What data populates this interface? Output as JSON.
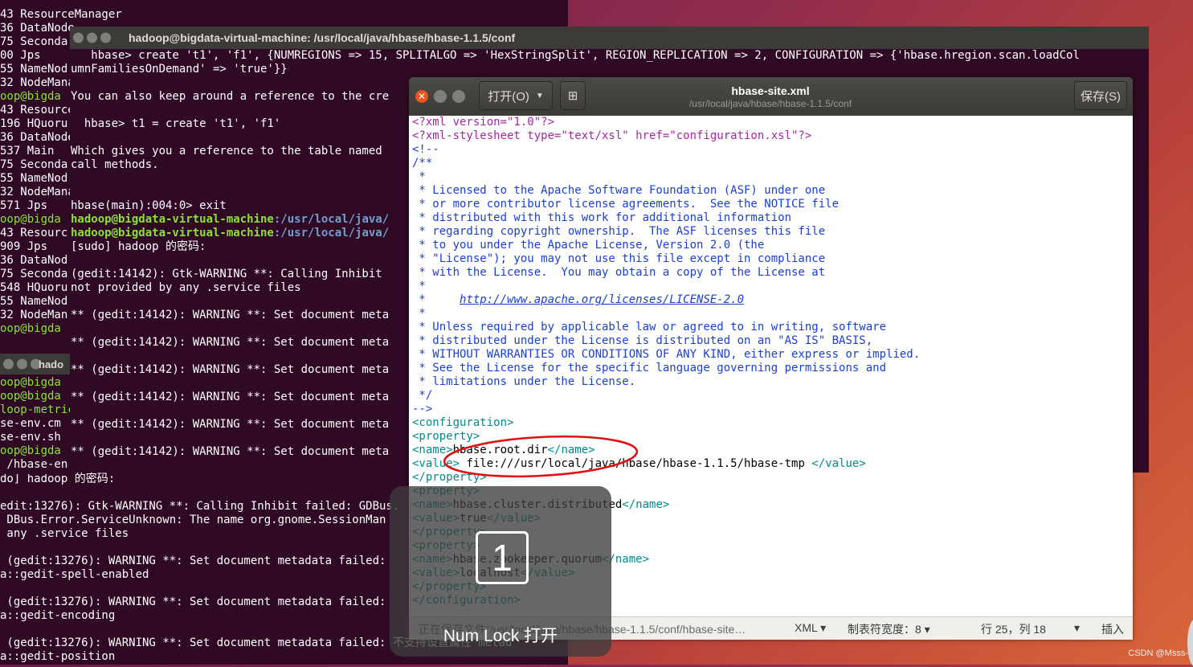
{
  "termA": {
    "lines": [
      "43 ResourceManager",
      "36 DataNode",
      "75 Seconda",
      "00 Jps",
      "55 NameNod",
      "32 NodeMana",
      "oop@bigda",
      "43 Resource",
      "196 HQuoru",
      "36 DataNode",
      "537 Main",
      "75 Seconda",
      "55 NameNod",
      "32 NodeMana",
      "571 Jps",
      "oop@bigda",
      "43 Resourc",
      "909 Jps",
      "36 DataNod",
      "75 Seconda",
      "548 HQuoru",
      "55 NameNod",
      "32 NodeMan",
      "oop@bigda"
    ],
    "bottom_lines": [
      "do] hadoop 的密码:",
      "",
      "edit:13276): Gtk-WARNING **: Calling Inhibit failed: GDBus.",
      " DBus.Error.ServiceUnknown: The name org.gnome.SessionMan",
      " any .service files",
      "",
      " (gedit:13276): WARNING **: Set document metadata failed: ",
      "a::gedit-spell-enabled",
      "",
      " (gedit:13276): WARNING **: Set document metadata failed: ",
      "a::gedit-encoding",
      "",
      " (gedit:13276): WARNING **: Set document metadata failed: 不支持设置属性 metad",
      "a::gedit-position"
    ]
  },
  "termC": {
    "title": "hado",
    "lines": [
      "oop@bigda",
      "oop@bigda",
      "loop-metric",
      "se-env.cm",
      "se-env.sh",
      "oop@bigda",
      " /hbase-en"
    ]
  },
  "termB": {
    "title": "hadoop@bigdata-virtual-machine: /usr/local/java/hbase/hbase-1.1.5/conf",
    "lines": [
      "   hbase> create 't1', 'f1', {NUMREGIONS => 15, SPLITALGO => 'HexStringSplit', REGION_REPLICATION => 2, CONFIGURATION => {'hbase.hregion.scan.loadCol",
      "umnFamiliesOnDemand' => 'true'}}",
      "",
      "You can also keep around a reference to the cre",
      "",
      "  hbase> t1 = create 't1', 'f1'",
      "",
      "Which gives you a reference to the table named",
      "call methods.",
      "",
      "",
      "hbase(main):004:0> exit"
    ],
    "prompt_user": "hadoop@bigdata-virtual-machine",
    "prompt_path": ":/usr/local/java/",
    "after_lines": [
      "[sudo] hadoop 的密码:",
      "",
      "(gedit:14142): Gtk-WARNING **: Calling Inhibit",
      "not provided by any .service files",
      "",
      "** (gedit:14142): WARNING **: Set document meta",
      "",
      "** (gedit:14142): WARNING **: Set document meta",
      "",
      "** (gedit:14142): WARNING **: Set document meta",
      "",
      "** (gedit:14142): WARNING **: Set document meta",
      "",
      "** (gedit:14142): WARNING **: Set document meta",
      "",
      "** (gedit:14142): WARNING **: Set document meta"
    ]
  },
  "gedit": {
    "open_label": "打开(O)",
    "save_label": "保存(S)",
    "title": "hbase-site.xml",
    "subtitle": "/usr/local/java/hbase/hbase-1.1.5/conf",
    "editor_lines": [
      {
        "cls": "c-pi",
        "text": "<?xml version=\"1.0\"?>"
      },
      {
        "cls": "c-pi",
        "text": "<?xml-stylesheet type=\"text/xsl\" href=\"configuration.xsl\"?>"
      },
      {
        "cls": "c-com",
        "text": "<!--"
      },
      {
        "cls": "c-com",
        "text": "/**"
      },
      {
        "cls": "c-com",
        "text": " *"
      },
      {
        "cls": "c-com",
        "text": " * Licensed to the Apache Software Foundation (ASF) under one"
      },
      {
        "cls": "c-com",
        "text": " * or more contributor license agreements.  See the NOTICE file"
      },
      {
        "cls": "c-com",
        "text": " * distributed with this work for additional information"
      },
      {
        "cls": "c-com",
        "text": " * regarding copyright ownership.  The ASF licenses this file"
      },
      {
        "cls": "c-com",
        "text": " * to you under the Apache License, Version 2.0 (the"
      },
      {
        "cls": "c-com",
        "text": " * \"License\"); you may not use this file except in compliance"
      },
      {
        "cls": "c-com",
        "text": " * with the License.  You may obtain a copy of the License at"
      },
      {
        "cls": "c-com",
        "text": " *"
      },
      {
        "cls": "c-com",
        "text": " *     ",
        "link": "http://www.apache.org/licenses/LICENSE-2.0"
      },
      {
        "cls": "c-com",
        "text": " *"
      },
      {
        "cls": "c-com",
        "text": " * Unless required by applicable law or agreed to in writing, software"
      },
      {
        "cls": "c-com",
        "text": " * distributed under the License is distributed on an \"AS IS\" BASIS,"
      },
      {
        "cls": "c-com",
        "text": " * WITHOUT WARRANTIES OR CONDITIONS OF ANY KIND, either express or implied."
      },
      {
        "cls": "c-com",
        "text": " * See the License for the specific language governing permissions and"
      },
      {
        "cls": "c-com",
        "text": " * limitations under the License."
      },
      {
        "cls": "c-com",
        "text": " */"
      },
      {
        "cls": "c-com",
        "text": "-->"
      },
      {
        "cls": "c-tag",
        "text": "<configuration>"
      },
      {
        "cls": "c-tag",
        "text": "<property>"
      },
      {
        "parts": [
          [
            "c-tag",
            "<name>"
          ],
          [
            "",
            "hbase.root.dir"
          ],
          [
            "c-tag",
            "</name>"
          ]
        ]
      },
      {
        "parts": [
          [
            "c-tag",
            "<value>"
          ],
          [
            "",
            " file:///usr/local/java/hbase/hbase-1.1.5/hbase-tmp "
          ],
          [
            "c-tag",
            "</value>"
          ]
        ]
      },
      {
        "cls": "c-tag",
        "text": "</property>"
      },
      {
        "cls": "c-tag",
        "text": "<property>"
      },
      {
        "parts": [
          [
            "c-tag",
            "<name>"
          ],
          [
            "",
            "hbase.cluster.distributed"
          ],
          [
            "c-tag",
            "</name>"
          ]
        ]
      },
      {
        "parts": [
          [
            "c-tag",
            "<value>"
          ],
          [
            "",
            "true"
          ],
          [
            "c-tag",
            "</value>"
          ]
        ]
      },
      {
        "cls": "c-tag",
        "text": "</property>"
      },
      {
        "cls": "c-tag",
        "text": "<property>"
      },
      {
        "parts": [
          [
            "c-tag",
            "<name>"
          ],
          [
            "",
            "hbase.zookeeper.quorum"
          ],
          [
            "c-tag",
            "</name>"
          ]
        ]
      },
      {
        "parts": [
          [
            "c-tag",
            "<value>"
          ],
          [
            "",
            "localhost"
          ],
          [
            "c-tag",
            "</value>"
          ]
        ]
      },
      {
        "cls": "c-tag",
        "text": "</property>"
      },
      {
        "cls": "c-tag",
        "text": "</configuration>"
      }
    ],
    "status": {
      "message": "正在保存文件\"/usr/local/java/hbase/hbase-1.1.5/conf/hbase-site…",
      "language": "XML ▾",
      "tab_width": "制表符宽度：8 ▾",
      "position": "行 25，列 18",
      "arrow": "▾",
      "mode": "插入"
    }
  },
  "osd": {
    "key": "1",
    "label": "Num  Lock  打开"
  },
  "watermark": "CSDN @Msss-",
  "colors": {
    "terminal_bg": "#300a24",
    "prompt_green": "#8ae234",
    "prompt_blue": "#729fcf",
    "close_orange": "#e95420"
  }
}
